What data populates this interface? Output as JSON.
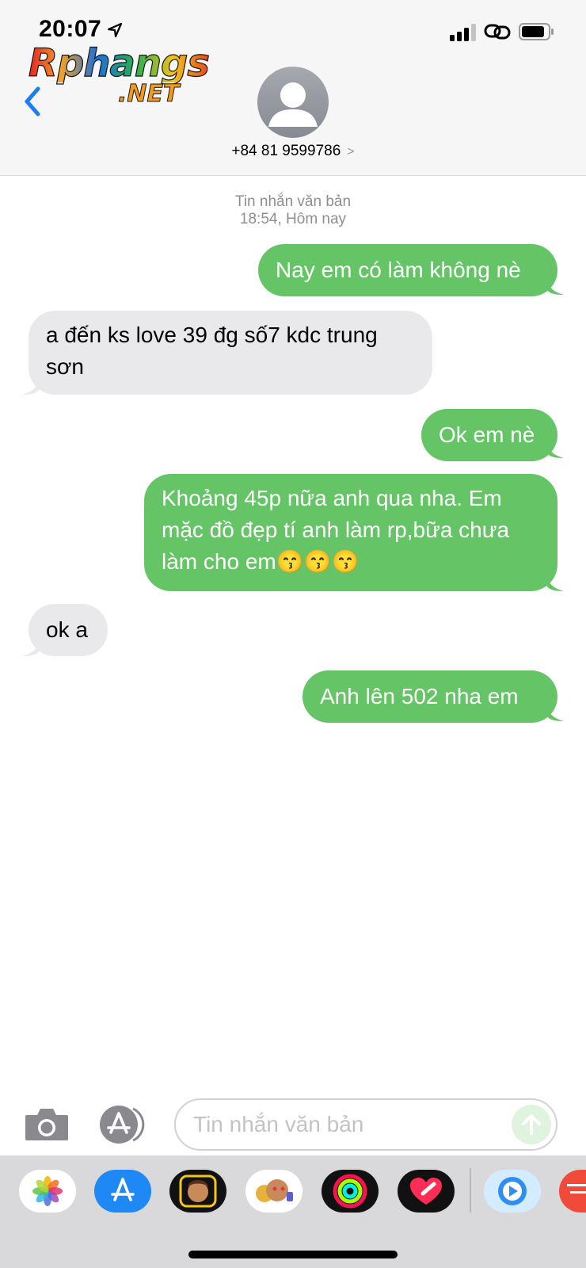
{
  "status_bar": {
    "time": "20:07"
  },
  "watermark": {
    "brand": "Rphangs",
    "domain": ".NET"
  },
  "header": {
    "contact": "+84 81 9599786",
    "contact_chevron": ">"
  },
  "thread": {
    "type_label": "Tin nhắn văn bản",
    "timestamp": "18:54, Hôm nay",
    "messages": [
      {
        "direction": "outgoing",
        "text": "Nay em có làm không nè"
      },
      {
        "direction": "incoming",
        "text": "a đến ks love 39 đg số7 kdc trung sơn"
      },
      {
        "direction": "outgoing",
        "text": "Ok em nè"
      },
      {
        "direction": "outgoing",
        "text": "Khoảng 45p nữa anh qua nha. Em mặc đồ đẹp tí anh làm rp,bữa chưa làm cho em😙😙😙"
      },
      {
        "direction": "incoming",
        "text": "ok a"
      },
      {
        "direction": "outgoing",
        "text": "Anh lên 502 nha em"
      }
    ]
  },
  "composer": {
    "placeholder": "Tin nhắn văn bản",
    "value": ""
  },
  "app_drawer": {
    "apps": [
      "photos-icon",
      "app-store-icon",
      "memoji-icon",
      "animoji-icon",
      "activity-icon",
      "digital-touch-icon",
      "clips-icon",
      "partial-app-icon"
    ]
  },
  "colors": {
    "outgoing_bubble": "#65c466",
    "incoming_bubble": "#e9e9eb",
    "accent": "#1a7cf7",
    "meta_text": "#8e8e93"
  }
}
